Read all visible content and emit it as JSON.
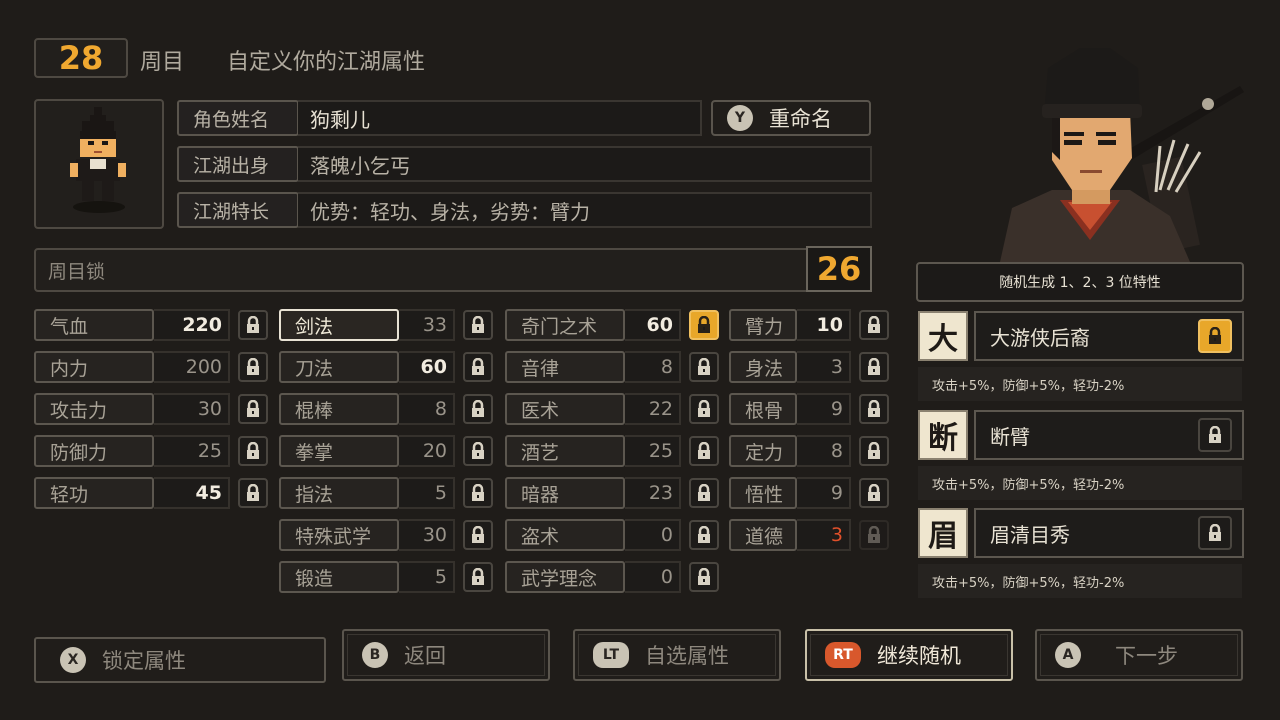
{
  "header": {
    "cycle_number": "28",
    "cycle_label": "周目",
    "subtitle": "自定义你的江湖属性"
  },
  "profile": {
    "name_label": "角色姓名",
    "name_value": "狗剩儿",
    "rename_pad": "Y",
    "rename_label": "重命名",
    "origin_label": "江湖出身",
    "origin_value": "落魄小乞丐",
    "specialty_label": "江湖特长",
    "specialty_value": "优势：轻功、身法，劣势：臂力"
  },
  "cycle_lock": {
    "label": "周目锁",
    "value": "26"
  },
  "stats": {
    "col1": [
      {
        "label": "气血",
        "value": "220"
      },
      {
        "label": "内力",
        "value": "200"
      },
      {
        "label": "攻击力",
        "value": "30"
      },
      {
        "label": "防御力",
        "value": "25"
      },
      {
        "label": "轻功",
        "value": "45"
      }
    ],
    "col2": [
      {
        "label": "剑法",
        "value": "33"
      },
      {
        "label": "刀法",
        "value": "60"
      },
      {
        "label": "棍棒",
        "value": "8"
      },
      {
        "label": "拳掌",
        "value": "20"
      },
      {
        "label": "指法",
        "value": "5"
      },
      {
        "label": "特殊武学",
        "value": "30"
      },
      {
        "label": "锻造",
        "value": "5"
      }
    ],
    "col3": [
      {
        "label": "奇门之术",
        "value": "60"
      },
      {
        "label": "音律",
        "value": "8"
      },
      {
        "label": "医术",
        "value": "22"
      },
      {
        "label": "酒艺",
        "value": "25"
      },
      {
        "label": "暗器",
        "value": "23"
      },
      {
        "label": "盗术",
        "value": "0"
      },
      {
        "label": "武学理念",
        "value": "0"
      }
    ],
    "col4": [
      {
        "label": "臂力",
        "value": "10"
      },
      {
        "label": "身法",
        "value": "3"
      },
      {
        "label": "根骨",
        "value": "9"
      },
      {
        "label": "定力",
        "value": "8"
      },
      {
        "label": "悟性",
        "value": "9"
      },
      {
        "label": "道德",
        "value": "3"
      }
    ]
  },
  "traits": {
    "header": "随机生成 1、2、3 位特性",
    "items": [
      {
        "icon_char": "大",
        "name": "大游侠后裔",
        "desc": "攻击+5%，防御+5%，轻功-2%"
      },
      {
        "icon_char": "断",
        "name": "断臂",
        "desc": "攻击+5%，防御+5%，轻功-2%"
      },
      {
        "icon_char": "眉",
        "name": "眉清目秀",
        "desc": "攻击+5%，防御+5%，轻功-2%"
      }
    ]
  },
  "buttons": [
    {
      "pad": "X",
      "label": "锁定属性"
    },
    {
      "pad": "B",
      "label": "返回"
    },
    {
      "pad": "LT",
      "label": "自选属性"
    },
    {
      "pad": "RT",
      "label": "继续随机"
    },
    {
      "pad": "A",
      "label": "下一步"
    }
  ],
  "colors": {
    "accent_gold": "#e8a72a",
    "rt_orange": "#d8582c",
    "warning_red": "#e0502a"
  }
}
